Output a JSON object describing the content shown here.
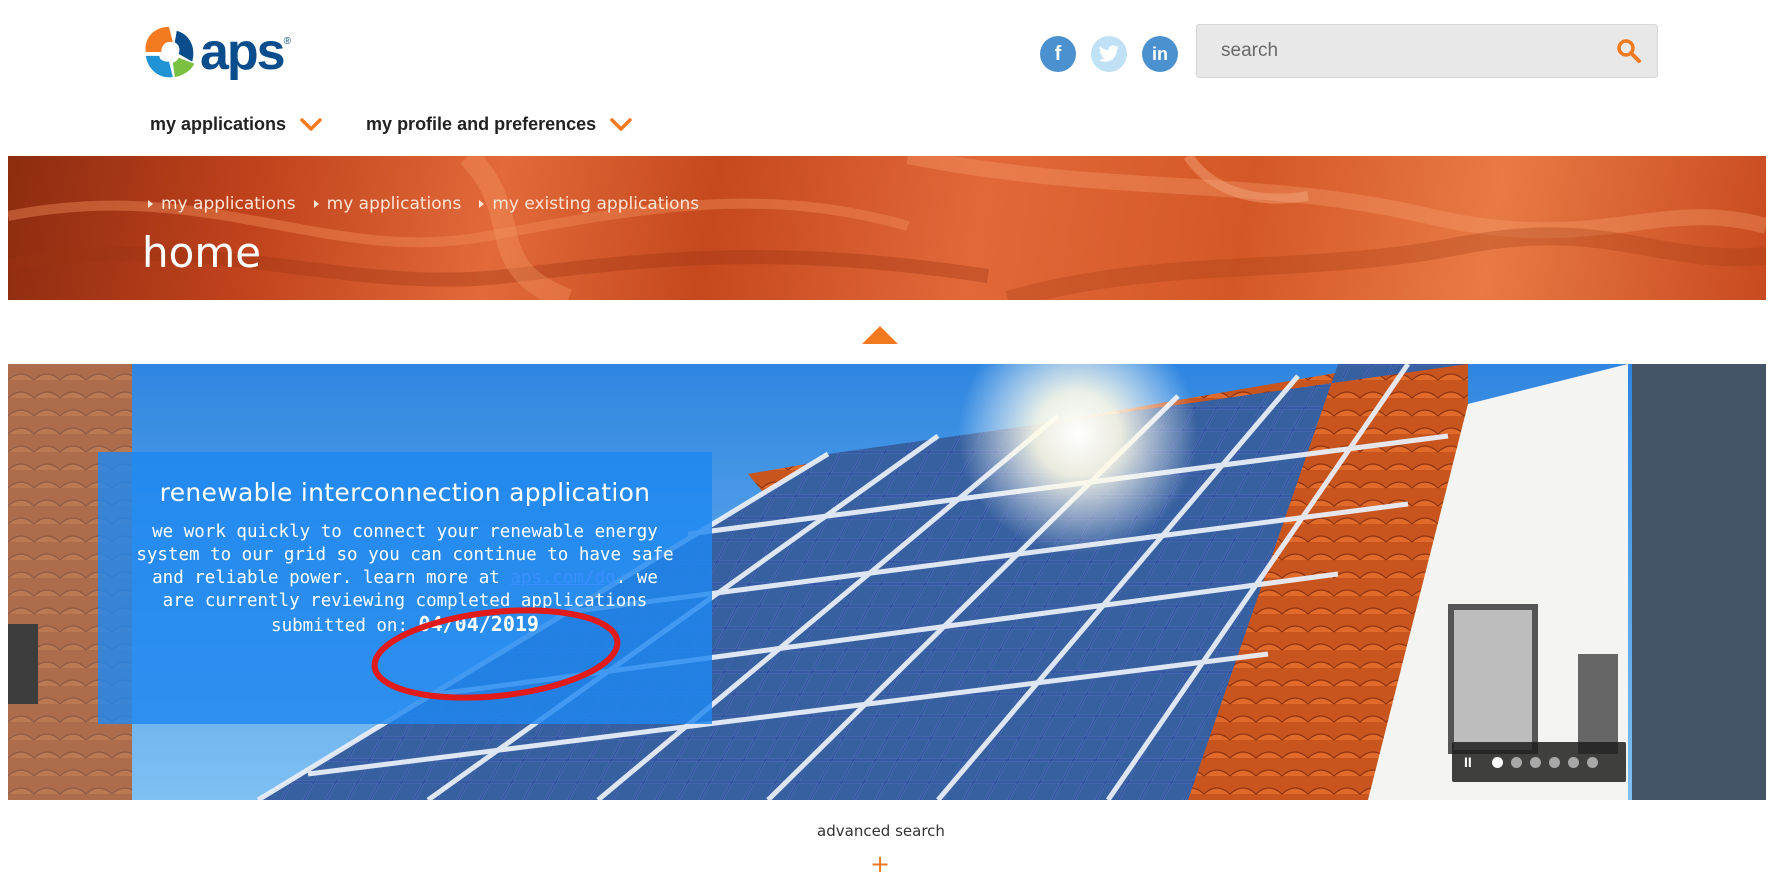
{
  "header": {
    "logo_text": "aps",
    "logo_mark": "®",
    "social": [
      {
        "icon": "facebook-icon",
        "glyph": "f"
      },
      {
        "icon": "twitter-icon",
        "glyph": "t"
      },
      {
        "icon": "linkedin-icon",
        "glyph": "in"
      }
    ],
    "search_placeholder": "search"
  },
  "nav": {
    "items": [
      {
        "label": "my applications"
      },
      {
        "label": "my profile and preferences"
      }
    ]
  },
  "banner": {
    "breadcrumbs": [
      "my applications",
      "my applications",
      "my existing applications"
    ],
    "title": "home"
  },
  "carousel": {
    "caption_title": "renewable interconnection application",
    "body_line1": "we work quickly to connect your renewable energy",
    "body_line2": "system to our grid so you can continue to have safe",
    "body_line3_pre": "and reliable power.  learn more at ",
    "link_text": "aps.com/dg",
    "body_line3_post": ". we",
    "body_line4": "are currently reviewing completed applications",
    "body_line5_pre": "submitted on: ",
    "date": "04/04/2019",
    "pause_label": "II",
    "slides_total": 6,
    "slide_active": 1
  },
  "footer": {
    "advanced_search": "advanced search",
    "expand": "+"
  },
  "colors": {
    "accent": "#f47a20",
    "brand_blue": "#0a4d8c",
    "caption_bg": "#1e88f0"
  }
}
